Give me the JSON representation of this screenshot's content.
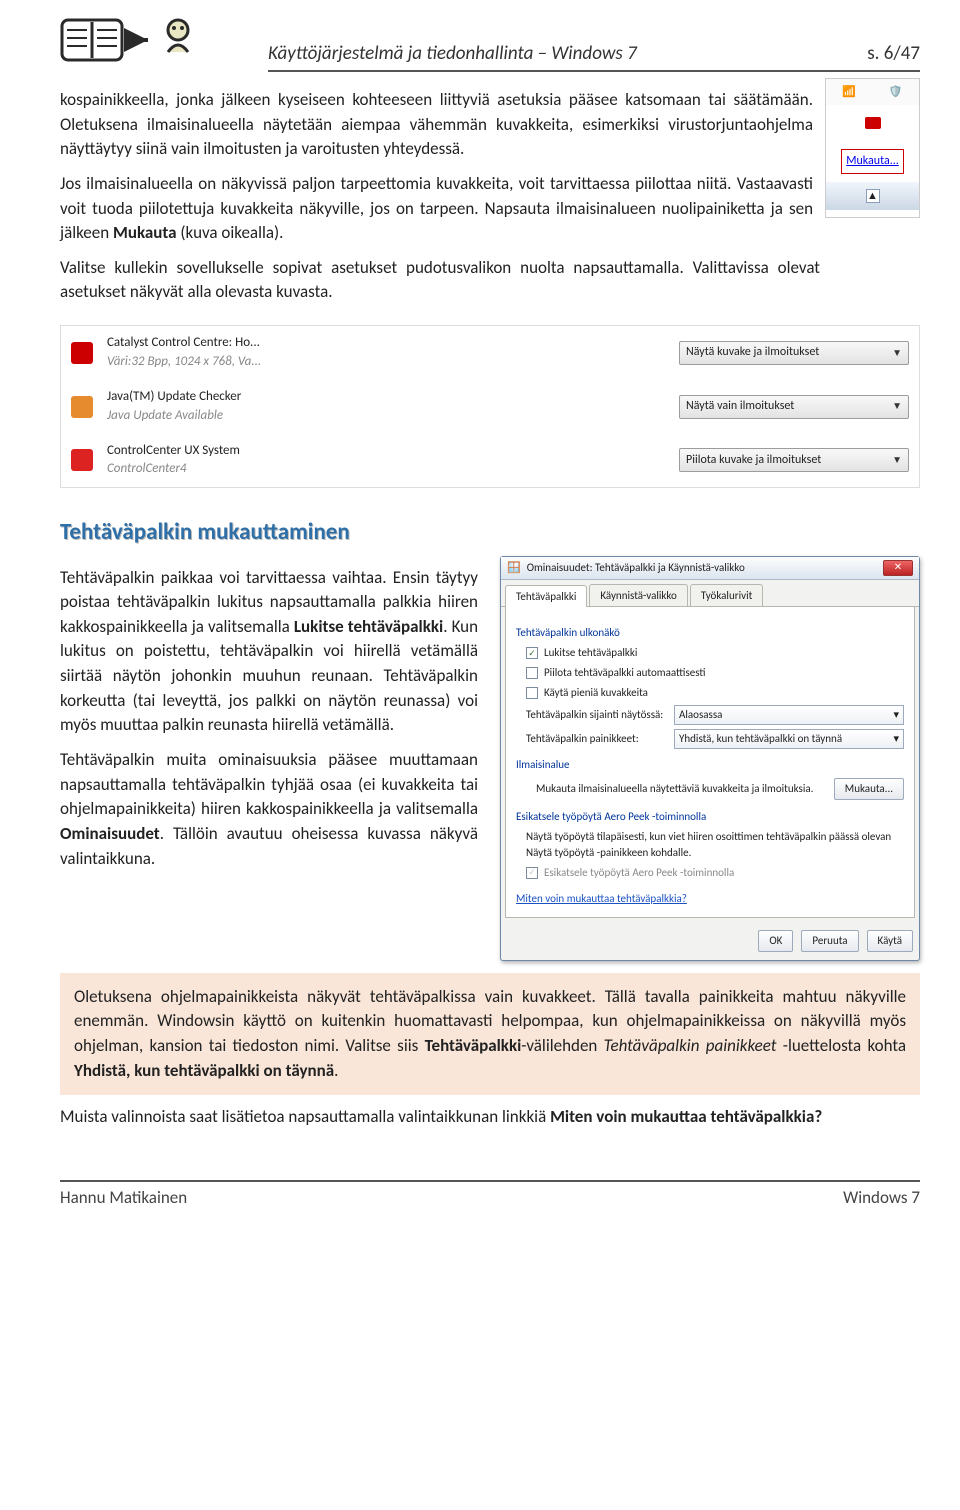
{
  "header": {
    "course": "Käyttöjärjestelmä ja tiedonhallinta – Windows 7",
    "pageof": "s. 6/47"
  },
  "para1": "kospainikkeella, jonka jälkeen kyseiseen kohteeseen liittyviä asetuksia pääsee katsomaan tai säätämään. Oletuksena ilmaisinalueella näytetään aiempaa vähemmän kuvakkeita, esimerkiksi virustorjuntaohjelma näyttäytyy siinä vain ilmoitusten ja varoitusten yhteydessä.",
  "para2_a": "Jos ilmaisinalueella on näkyvissä paljon tarpeettomia kuvakkeita, voit tarvittaessa piilottaa niitä. Vastaavasti voit tuoda piilotettuja kuvakkeita näkyville, jos on tarpeen. Napsauta ilmaisinalueen nuolipainiketta ja sen jälkeen ",
  "para2_bold": "Mukauta",
  "para2_b": " (kuva oikealla).",
  "para3": "Valitse kullekin sovellukselle sopivat asetukset pudotusvalikon nuolta napsauttamalla. Valittavissa olevat asetukset näkyvät alla olevasta kuvasta.",
  "tray": {
    "mukauta": "Mukauta..."
  },
  "apps": {
    "r1_name": "Catalyst Control Centre: Ho...",
    "r1_sub": "Väri:32 Bpp, 1024 x 768, Va...",
    "r1_sel": "Näytä kuvake ja ilmoitukset",
    "r2_name": "Java(TM) Update Checker",
    "r2_sub": "Java Update Available",
    "r2_sel": "Näytä vain ilmoitukset",
    "r3_name": "ControlCenter UX System",
    "r3_sub": "ControlCenter4",
    "r3_sel": "Piilota kuvake ja ilmoitukset"
  },
  "section_heading": "Tehtäväpalkin mukauttaminen",
  "col_para1_a": "Tehtäväpalkin paikkaa voi tarvittaessa vaihtaa. Ensin täytyy poistaa tehtäväpalkin lukitus napsauttamalla palkkia hiiren kakkospainikkeella ja valitsemalla ",
  "col_para1_bold": "Lukitse tehtäväpalkki",
  "col_para1_b": ". Kun lukitus on poistettu, tehtäväpalkin voi hiirellä vetämällä siirtää näytön johonkin muuhun reunaan. Tehtäväpalkin korkeutta (tai leveyttä, jos palkki on näytön reunassa) voi myös muuttaa palkin reunasta hiirellä vetämällä.",
  "col_para2_a": "Tehtäväpalkin muita ominaisuuksia pääsee muuttamaan napsauttamalla tehtäväpalkin tyhjää osaa (ei kuvakkeita tai ohjelmapainikkeita) hiiren kakkospainikkeella ja valitsemalla ",
  "col_para2_bold": "Ominaisuudet",
  "col_para2_b": ". Tällöin avautuu oheisessa kuvassa näkyvä valintaikkuna.",
  "dialog": {
    "title": "Ominaisuudet: Tehtäväpalkki ja Käynnistä-valikko",
    "tab1": "Tehtäväpalkki",
    "tab2": "Käynnistä-valikko",
    "tab3": "Työkalurivit",
    "sec_appearance": "Tehtäväpalkin ulkonäkö",
    "chk_lock": "Lukitse tehtäväpalkki",
    "chk_autohide": "Piilota tehtäväpalkki automaattisesti",
    "chk_small": "Käytä pieniä kuvakkeita",
    "pos_label": "Tehtäväpalkin sijainti näytössä:",
    "pos_value": "Alaosassa",
    "btn_label": "Tehtäväpalkin painikkeet:",
    "btn_value": "Yhdistä, kun tehtäväpalkki on täynnä",
    "sec_tray": "Ilmaisinalue",
    "tray_desc": "Mukauta ilmaisinalueella näytettäviä kuvakkeita ja ilmoituksia.",
    "btn_customize": "Mukauta...",
    "sec_aero": "Esikatsele työpöytä Aero Peek -toiminnolla",
    "aero_desc": "Näytä työpöytä tilapäisesti, kun viet hiiren osoittimen tehtäväpalkin päässä olevan Näytä työpöytä -painikkeen kohdalle.",
    "chk_aero": "Esikatsele työpöytä Aero Peek -toiminnolla",
    "help_link": "Miten voin mukauttaa tehtäväpalkkia?",
    "ok": "OK",
    "cancel": "Peruuta",
    "apply": "Käytä"
  },
  "highlight_a": "Oletuksena ohjelmapainikkeista näkyvät tehtäväpalkissa vain kuvakkeet. Tällä tavalla painikkeita mahtuu näkyville enemmän. Windowsin käyttö on kuitenkin huomattavasti helpompaa, kun ohjelmapainikkeissa on näkyvillä myös ohjelman, kansion tai tiedoston nimi. Valitse siis ",
  "highlight_bold1": "Tehtäväpalkki",
  "highlight_b": "-välilehden ",
  "highlight_italic": "Tehtäväpalkin painikkeet",
  "highlight_c": " -luettelosta kohta ",
  "highlight_bold2": "Yhdistä, kun tehtäväpalkki on täynnä",
  "highlight_d": ".",
  "closing_a": "Muista valinnoista saat lisätietoa napsauttamalla valintaikkunan linkkiä ",
  "closing_bold": "Miten voin mukauttaa tehtäväpalkkia?",
  "footer": {
    "author": "Hannu Matikainen",
    "product": "Windows 7"
  }
}
